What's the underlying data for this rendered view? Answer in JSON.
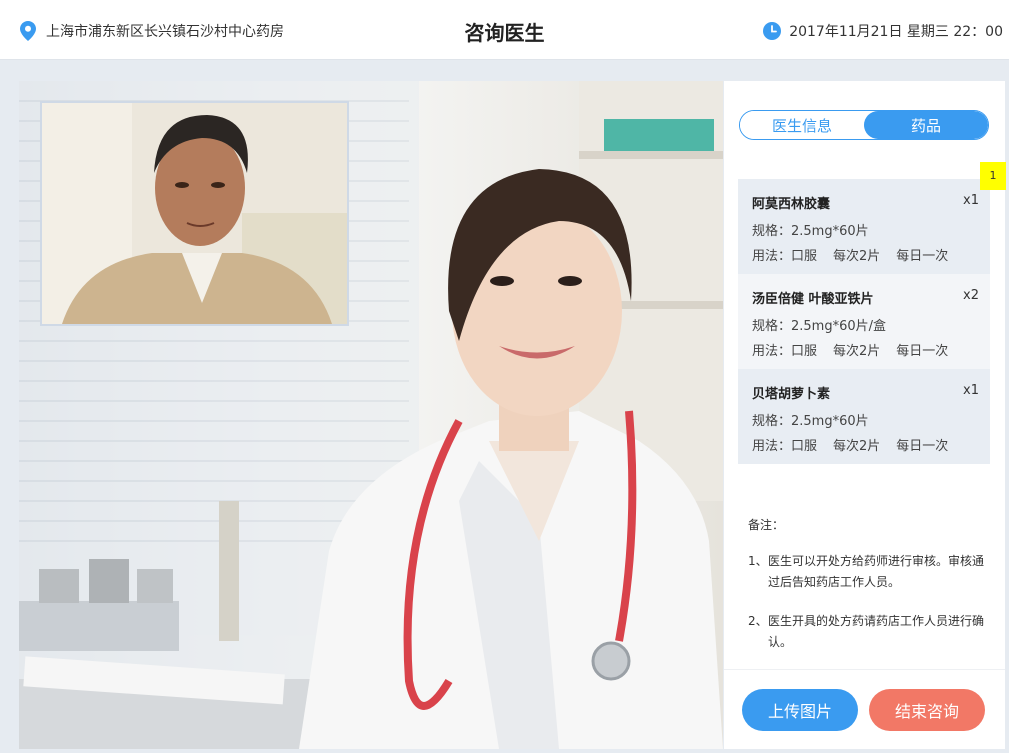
{
  "header": {
    "location": "上海市浦东新区长兴镇石沙村中心药房",
    "title": "咨询医生",
    "datetime": "2017年11月21日  星期三  22：00"
  },
  "tabs": [
    {
      "label": "医生信息",
      "active": false
    },
    {
      "label": "药品",
      "active": true
    }
  ],
  "badge": "1",
  "medicines": [
    {
      "name": "阿莫西林胶囊",
      "qty": "x1",
      "spec": "规格：2.5mg*60片",
      "usage": [
        "用法：口服",
        "每次2片",
        "每日一次"
      ]
    },
    {
      "name": "汤臣倍健 叶酸亚铁片",
      "qty": "x2",
      "spec": "规格：2.5mg*60片/盒",
      "usage": [
        "用法：口服",
        "每次2片",
        "每日一次"
      ]
    },
    {
      "name": "贝塔胡萝卜素",
      "qty": "x1",
      "spec": "规格：2.5mg*60片",
      "usage": [
        "用法：口服",
        "每次2片",
        "每日一次"
      ]
    }
  ],
  "notes": {
    "title": "备注：",
    "items": [
      {
        "num": "1、",
        "text": "医生可以开处方给药师进行审核。审核通过后告知药店工作人员。"
      },
      {
        "num": "2、",
        "text": "医生开具的处方药请药店工作人员进行确认。"
      }
    ]
  },
  "buttons": {
    "upload": "上传图片",
    "end": "结束咨询"
  },
  "colors": {
    "accent": "#3a9bf0",
    "end_button": "#f27866",
    "badge": "#ffff00"
  }
}
